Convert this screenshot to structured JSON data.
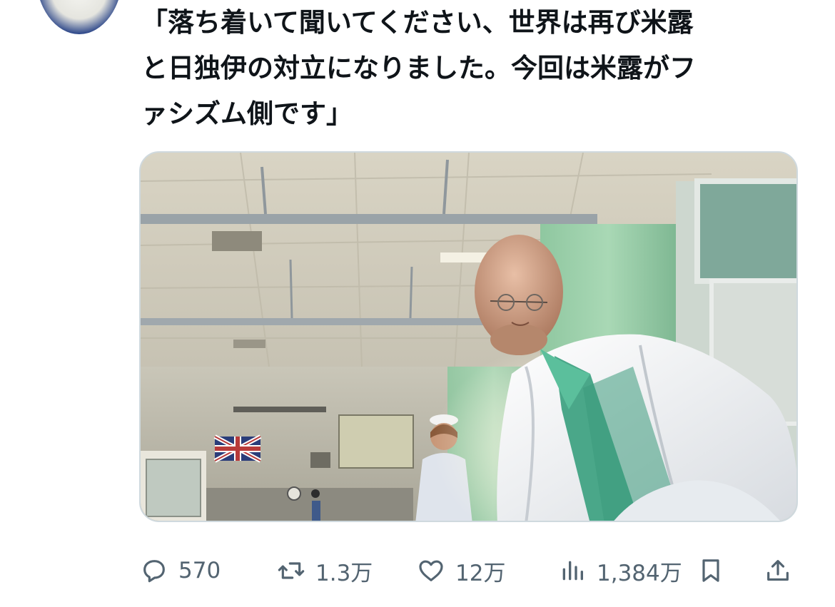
{
  "tweet": {
    "text": "「落ち着いて聞いてください、世界は再び米露\nと日独伊の対立になりました。今回は米露がフ\nァシズム側です」"
  },
  "media": {
    "description_icon": "image"
  },
  "actions": {
    "reply_count": "570",
    "retweet_count": "1.3万",
    "like_count": "12万",
    "view_count": "1,384万"
  },
  "icons": {
    "reply": "reply-icon",
    "retweet": "retweet-icon",
    "like": "heart-icon",
    "views": "views-icon",
    "bookmark": "bookmark-icon",
    "share": "share-icon"
  },
  "colors": {
    "text": "#0f1419",
    "secondary": "#536471",
    "border": "#cfd9de"
  }
}
